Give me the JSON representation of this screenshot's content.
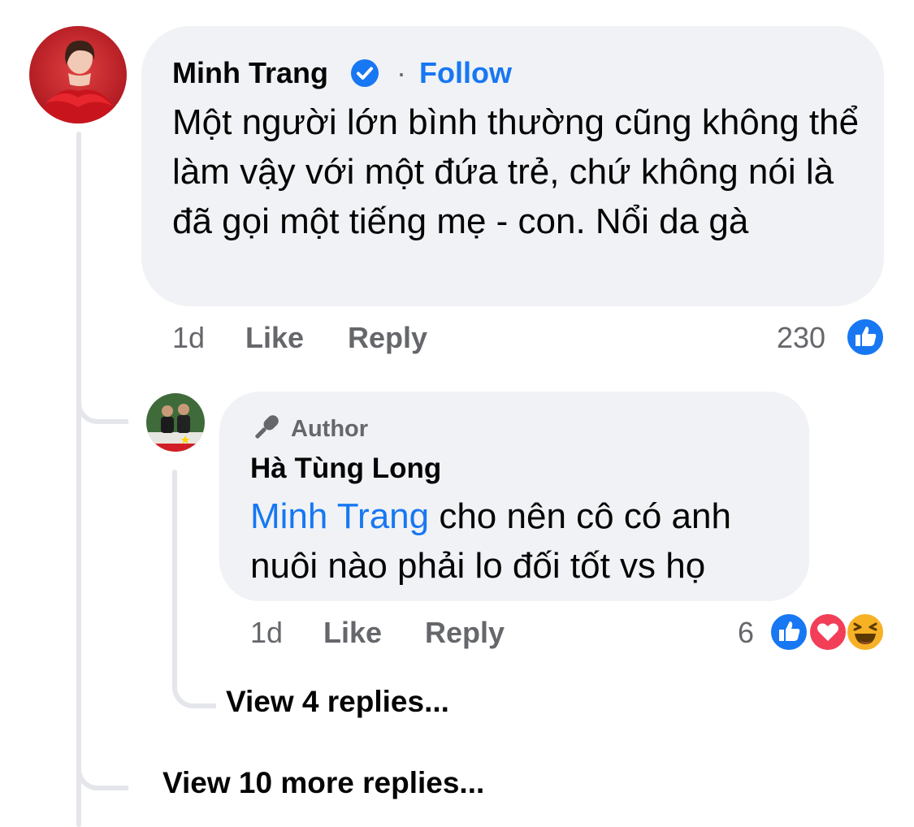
{
  "comment": {
    "author": "Minh Trang",
    "follow_separator": "·",
    "follow_label": "Follow",
    "text": "Một người lớn bình thường cũng không thể làm vậy với một đứa trẻ, chứ không nói là đã gọi một tiếng mẹ - con. Nổi da gà",
    "time": "1d",
    "like_label": "Like",
    "reply_label": "Reply",
    "reaction_count": "230",
    "reactions": [
      "like-icon"
    ]
  },
  "reply": {
    "badge_label": "Author",
    "author": "Hà Tùng Long",
    "mention": "Minh Trang",
    "text": " cho nên cô có anh nuôi nào phải lo đối tốt vs họ",
    "time": "1d",
    "like_label": "Like",
    "reply_label": "Reply",
    "reaction_count": "6",
    "reactions": [
      "like-icon",
      "love-icon",
      "haha-icon"
    ]
  },
  "view_replies_label": "View 4 replies...",
  "view_more_label": "View 10 more replies...",
  "colors": {
    "bubble": "#f0f2f5",
    "accent": "#1877f2",
    "muted": "#65676b",
    "love": "#f33e58",
    "haha": "#f7b125",
    "thread_line": "#e4e6eb"
  }
}
